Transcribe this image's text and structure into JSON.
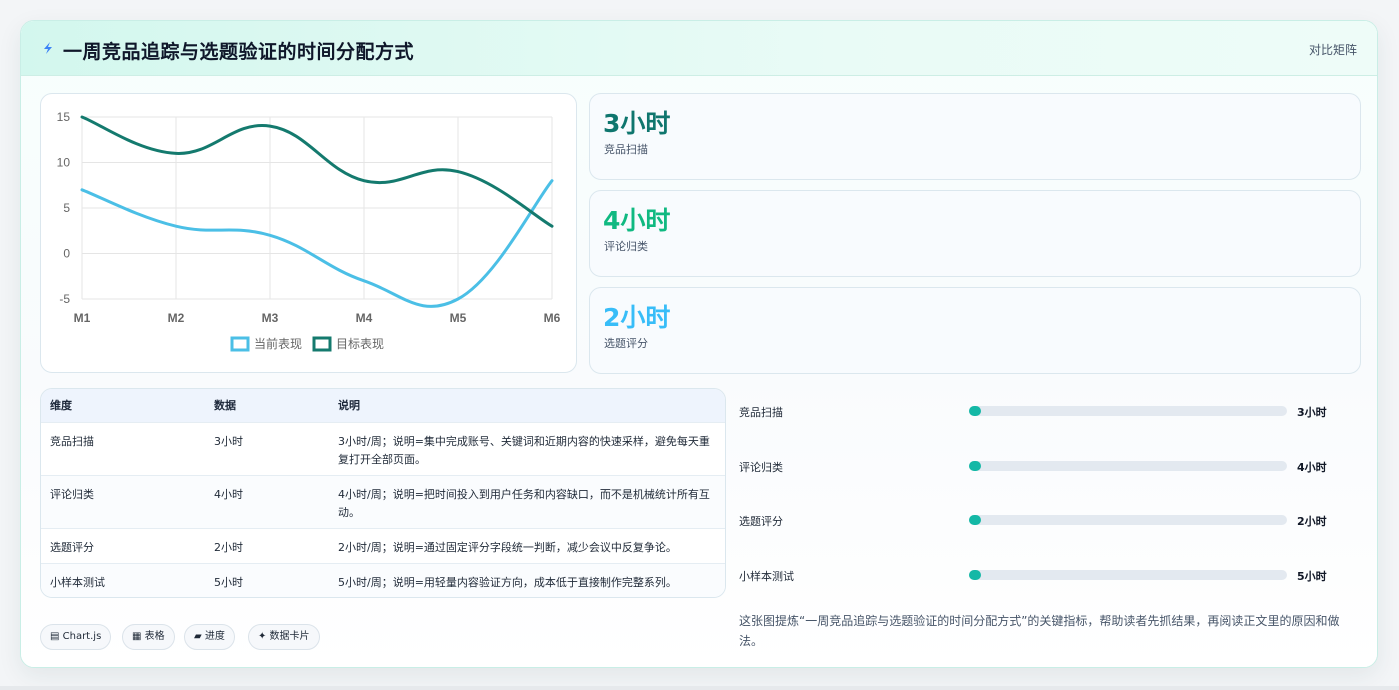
{
  "header": {
    "title": "一周竞品追踪与选题验证的时间分配方式",
    "action_label": "对比矩阵",
    "icon": "lightning-icon"
  },
  "chart_data": {
    "type": "line",
    "categories": [
      "M1",
      "M2",
      "M3",
      "M4",
      "M5",
      "M6"
    ],
    "series": [
      {
        "name": "当前表现",
        "values": [
          7,
          3,
          2,
          -3,
          -5,
          8
        ],
        "color": "#4bbfe6"
      },
      {
        "name": "目标表现",
        "values": [
          15,
          11,
          14,
          8,
          9,
          3
        ],
        "color": "#147a6e"
      }
    ],
    "ylim": [
      -5,
      15
    ],
    "yticks": [
      "15",
      "10",
      "5",
      "0",
      "-5"
    ],
    "grid": true,
    "legend": "bottom"
  },
  "stats": [
    {
      "value": "3小时",
      "label": "竞品扫描",
      "color": "#0f766e"
    },
    {
      "value": "4小时",
      "label": "评论归类",
      "color": "#10b981"
    },
    {
      "value": "2小时",
      "label": "选题评分",
      "color": "#38bdf8"
    }
  ],
  "table": {
    "headers": [
      "维度",
      "数据",
      "说明"
    ],
    "rows": [
      {
        "dim": "竞品扫描",
        "data": "3小时",
        "note": "3小时/周；说明=集中完成账号、关键词和近期内容的快速采样，避免每天重复打开全部页面。"
      },
      {
        "dim": "评论归类",
        "data": "4小时",
        "note": "4小时/周；说明=把时间投入到用户任务和内容缺口，而不是机械统计所有互动。"
      },
      {
        "dim": "选题评分",
        "data": "2小时",
        "note": "2小时/周；说明=通过固定评分字段统一判断，减少会议中反复争论。"
      },
      {
        "dim": "小样本测试",
        "data": "5小时",
        "note": "5小时/周；说明=用轻量内容验证方向，成本低于直接制作完整系列。"
      }
    ]
  },
  "tags": [
    "▤ Chart.js",
    "▦ 表格",
    "▰ 进度",
    "✦ 数据卡片"
  ],
  "progress": [
    {
      "label": "竞品扫描",
      "value": "3小时",
      "fraction": 0.02
    },
    {
      "label": "评论归类",
      "value": "4小时",
      "fraction": 0.02
    },
    {
      "label": "选题评分",
      "value": "2小时",
      "fraction": 0.02
    },
    {
      "label": "小样本测试",
      "value": "5小时",
      "fraction": 0.02
    }
  ],
  "summary": "这张图提炼“一周竞品追踪与选题验证的时间分配方式”的关键指标，帮助读者先抓结果，再阅读正文里的原因和做法。"
}
